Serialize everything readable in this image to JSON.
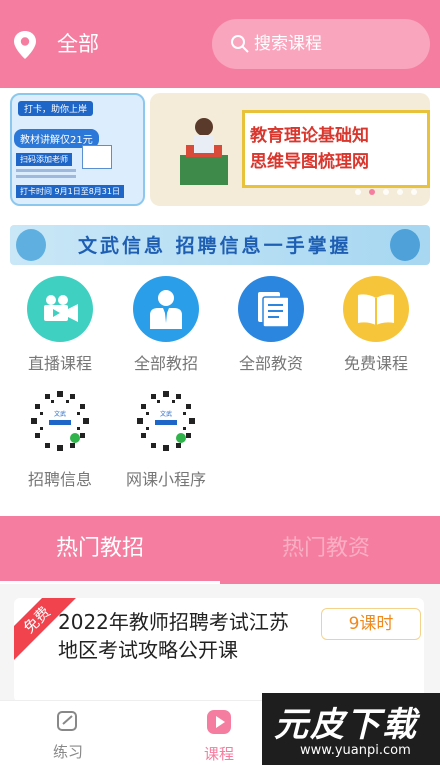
{
  "header": {
    "location_label": "全部",
    "search_placeholder": "搜索课程"
  },
  "carousel": {
    "left_card": {
      "tag_top": "打卡，助你上岸",
      "tag_price": "教材讲解仅21元",
      "tag_teacher": "扫码添加老师",
      "tag_time": "打卡时间 9月1日至8月31日"
    },
    "right_card": {
      "line1": "教育理论基础知",
      "line2": "思维导图梳理网"
    },
    "dots": [
      false,
      true,
      false,
      false,
      false
    ]
  },
  "strip": {
    "text": "文武信息  招聘信息一手掌握"
  },
  "grid": {
    "items": [
      {
        "label": "直播课程",
        "icon": "video-camera-icon",
        "color": "#3fd0c2"
      },
      {
        "label": "全部教招",
        "icon": "teacher-icon",
        "color": "#2b9ee9"
      },
      {
        "label": "全部教资",
        "icon": "document-icon",
        "color": "#2b86e0"
      },
      {
        "label": "免费课程",
        "icon": "book-icon",
        "color": "#f7c53a"
      },
      {
        "label": "招聘信息",
        "icon": "mini-program-code-icon"
      },
      {
        "label": "网课小程序",
        "icon": "mini-program-code-icon"
      }
    ]
  },
  "tabs": {
    "active": "热门教招",
    "inactive": "热门教资"
  },
  "course": {
    "ribbon": "免费",
    "title": "2022年教师招聘考试江苏地区考试攻略公开课",
    "hours": "9课时"
  },
  "nav": {
    "practice": "练习",
    "course": "课程"
  },
  "watermark": {
    "brand_a": "元皮",
    "brand_b": "下载",
    "url": "www.yuanpi.com"
  },
  "colors": {
    "primary": "#f57ea0",
    "ribbon": "#f0434e",
    "hours": "#f08a1e"
  }
}
